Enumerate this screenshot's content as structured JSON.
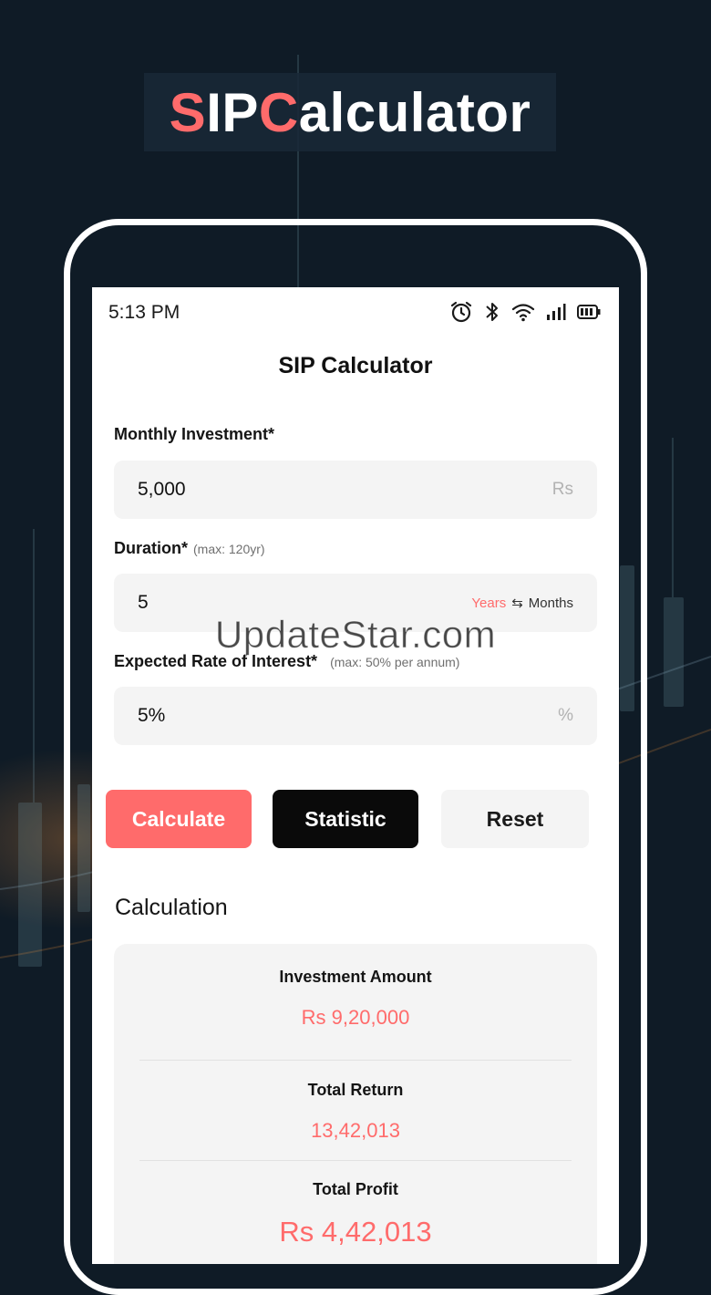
{
  "promo": {
    "title_accent_1": "S",
    "title_rest_1": "IP ",
    "title_accent_2": "C",
    "title_rest_2": "alculator"
  },
  "status_bar": {
    "time": "5:13 PM"
  },
  "app": {
    "title": "SIP Calculator"
  },
  "form": {
    "monthly_investment": {
      "label": "Monthly Investment*",
      "value": "5,000",
      "suffix": "Rs"
    },
    "duration": {
      "label": "Duration*",
      "hint": "(max: 120yr)",
      "value": "5",
      "unit_selected": "Years",
      "unit_other": "Months"
    },
    "interest": {
      "label": "Expected Rate of Interest*",
      "hint": "(max: 50% per annum)",
      "value": "5%",
      "suffix": "%"
    }
  },
  "buttons": {
    "calculate": "Calculate",
    "statistic": "Statistic",
    "reset": "Reset"
  },
  "calculation": {
    "title": "Calculation",
    "investment_label": "Investment Amount",
    "investment_value": "Rs 9,20,000",
    "return_label": "Total Return",
    "return_value": "13,42,013",
    "profit_label": "Total Profit",
    "profit_value": "Rs 4,42,013"
  },
  "watermark": "UpdateStar.com",
  "colors": {
    "accent": "#ff6b6b",
    "background": "#0f1b26",
    "field_bg": "#f4f4f4",
    "dark_button": "#0a0a0a"
  }
}
